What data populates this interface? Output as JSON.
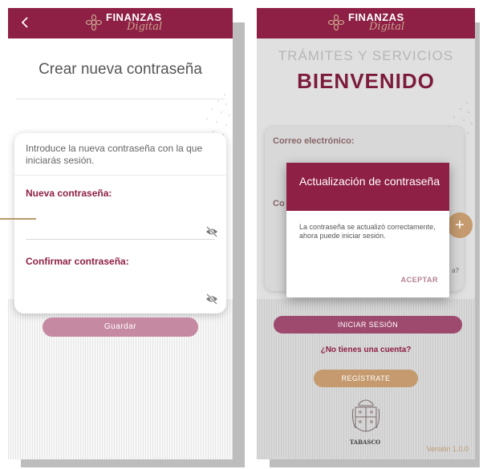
{
  "colors": {
    "brand": "#8e1f45",
    "gold": "#c49a6e",
    "label": "#8e1f45"
  },
  "logo": {
    "title": "FINANZAS",
    "script": "Digital",
    "emblem_icon": "flower-emblem-icon"
  },
  "screen1": {
    "back_icon": "chevron-left-icon",
    "title": "Crear nueva contraseña",
    "intro": "Introduce la nueva contraseña con la que iniciarás sesión.",
    "new_password_label": "Nueva contraseña:",
    "new_password_value": "",
    "confirm_password_label": "Confirmar contraseña:",
    "confirm_password_value": "",
    "visibility_icon": "eye-off-icon",
    "save_label": "Guardar"
  },
  "screen2": {
    "subtitle": "TRÁMITES Y SERVICIOS",
    "welcome": "BIENVENIDO",
    "email_label": "Correo electrónico:",
    "password_label_partial": "Co",
    "forgot_partial": "a?",
    "fab_icon": "plus-icon",
    "dialog": {
      "title": "Actualización de contraseña",
      "message": "La contraseña se actualizó correctamente, ahora puede iniciar sesión.",
      "accept_label": "ACEPTAR"
    },
    "login_label": "INICIAR SESIÓN",
    "no_account": "¿No tienes una cuenta?",
    "register_label": "REGÍSTRATE",
    "crest_label": "TABASCO",
    "version": "Versión 1.0.0"
  }
}
